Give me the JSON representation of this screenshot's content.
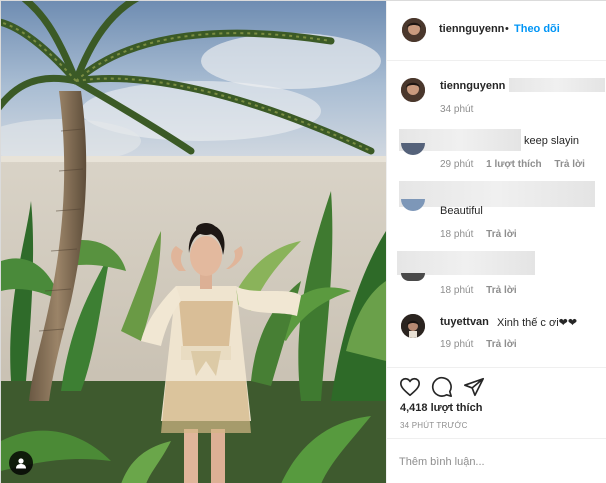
{
  "header": {
    "username": "tiennguyenn",
    "separator": "•",
    "follow_label": "Theo dõi"
  },
  "caption": {
    "username": "tiennguyenn",
    "time": "34 phút"
  },
  "comments": [
    {
      "username": "",
      "text": "keep slayin",
      "time": "29 phút",
      "likes": "1 lượt thích",
      "reply": "Trả lời"
    },
    {
      "username": "",
      "text": "Beautiful",
      "time": "18 phút",
      "reply": "Trả lời"
    },
    {
      "username": "",
      "text": "",
      "time": "18 phút",
      "reply": "Trả lời"
    },
    {
      "username": "tuyettvan",
      "text": "Xinh thế c ơi❤❤",
      "time": "19 phút",
      "reply": "Trả lời"
    }
  ],
  "actions": {
    "like_icon": "heart-icon",
    "comment_icon": "comment-icon",
    "share_icon": "share-icon"
  },
  "stats": {
    "likes": "4,418 lượt thích",
    "time_ago": "34 PHÚT TRƯỚC"
  },
  "add_comment": {
    "placeholder": "Thêm bình luận..."
  },
  "colors": {
    "accent": "#0095f6",
    "text": "#262626",
    "secondary": "#8e8e8e",
    "border": "#efefef"
  }
}
